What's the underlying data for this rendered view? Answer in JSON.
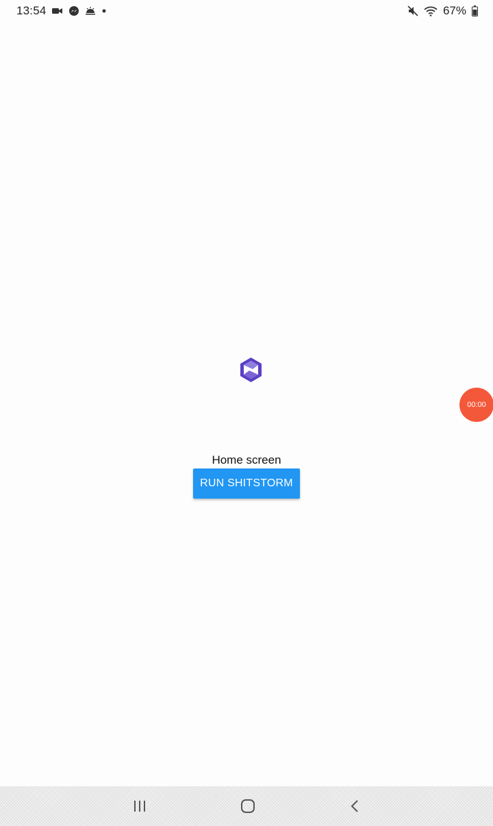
{
  "status_bar": {
    "time": "13:54",
    "left_icons": [
      "video-camera-icon",
      "messenger-icon",
      "weather-icon",
      "notification-dot-icon"
    ],
    "right_icons": [
      "mute-icon",
      "wifi-icon",
      "battery-icon"
    ],
    "battery_text": "67%"
  },
  "main": {
    "home_label": "Home screen",
    "run_button_label": "RUN SHITSTORM"
  },
  "record_bubble": {
    "time": "00:00"
  },
  "nav_bar": {
    "items": [
      "recents-icon",
      "home-icon",
      "back-icon"
    ]
  },
  "colors": {
    "button": "#2196f3",
    "record_bubble": "#f4583a",
    "logo_primary": "#5b3fc4",
    "logo_secondary": "#8f7fe0"
  }
}
